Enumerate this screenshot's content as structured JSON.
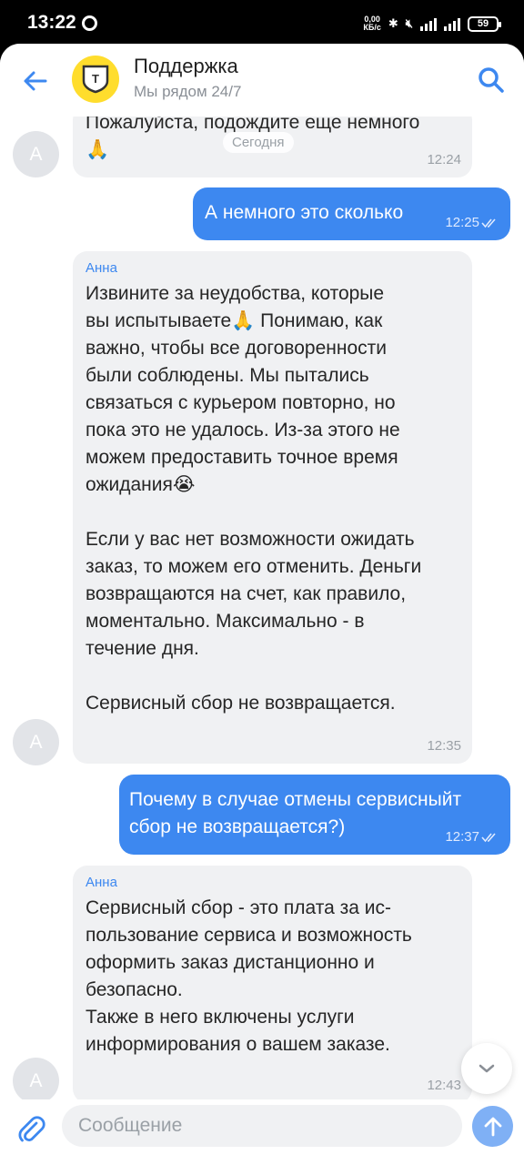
{
  "status_bar": {
    "time": "13:22",
    "net_speed": "0,00",
    "net_unit": "КБ/с",
    "battery": "59"
  },
  "header": {
    "title": "Поддержка",
    "subtitle": "Мы рядом 24/7",
    "logo_letter": "Т"
  },
  "chat": {
    "date_label": "Сегодня",
    "messages": [
      {
        "text": "Пожалуйста, подождите еще немного\n🙏",
        "time": "12:24",
        "avatar": "А"
      },
      {
        "text": "А немного это сколько",
        "time": "12:25"
      },
      {
        "sender": "Анна",
        "text": "Извините за неудобства, которые\nвы испытываете🙏 Понимаю, как\nважно, чтобы все договоренности\nбыли соблюдены. Мы пытались\nсвязаться с курьером повторно, но\nпока это не удалось. Из-за этого не\nможем предоставить точное время\nожидания😭\n\nЕсли у вас нет возможности ожидать\nзаказ, то можем его отменить. Деньги\nвозвращаются на счет, как правило,\nмоментально. Максимально - в\nтечение дня.\n\nСервисный сбор не возвращается.",
        "time": "12:35",
        "avatar": "А"
      },
      {
        "text": "Почему в случае отмены сервисныйт\nсбор не возвращается?)",
        "time": "12:37"
      },
      {
        "sender": "Анна",
        "text": "Сервисный сбор - это плата за ис-\nпользование сервиса и возможность\nоформить заказ дистанционно и\nбезопасно.\nТакже в него включены услуги\nинформирования о вашем заказе.",
        "time": "12:43",
        "avatar": "А"
      }
    ]
  },
  "input": {
    "placeholder": "Сообщение"
  },
  "colors": {
    "accent": "#3d88f0",
    "incoming_bubble": "#f0f1f3",
    "brand_yellow": "#ffdd2d",
    "send_disabled": "#7fb0f5"
  },
  "icons": {
    "back": "arrow-left-icon",
    "search": "search-icon",
    "attach": "paperclip-icon",
    "send": "arrow-up-icon",
    "scroll": "chevron-down-icon",
    "read": "double-check-icon"
  }
}
